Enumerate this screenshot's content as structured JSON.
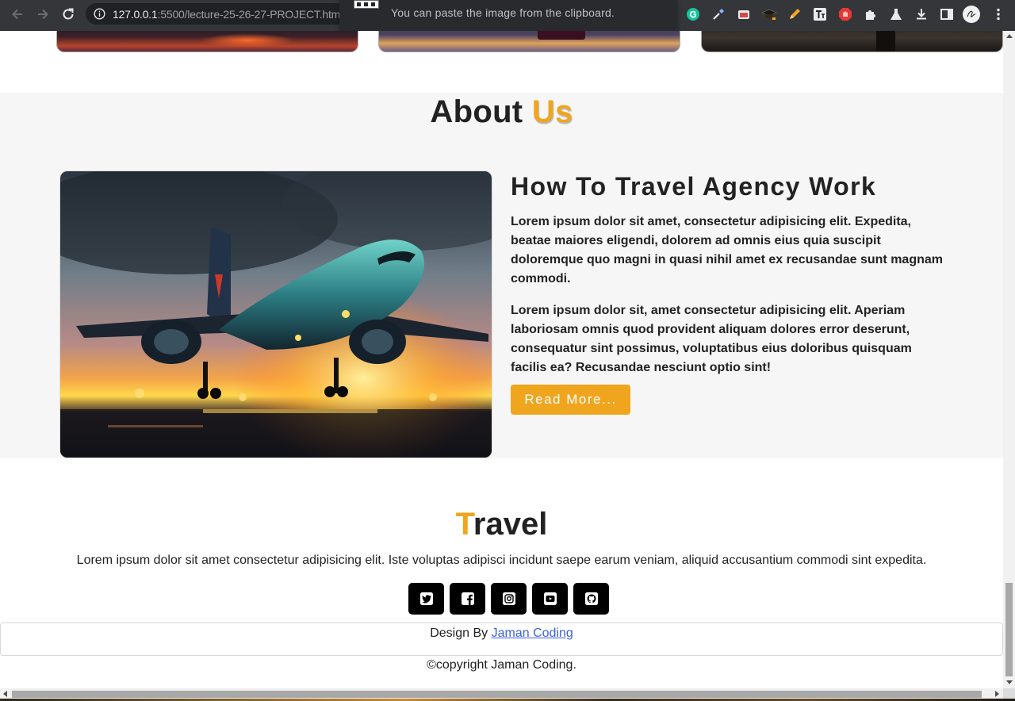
{
  "browser": {
    "url_host": "127.0.0.1",
    "url_rest": ":5500/lecture-25-26-27-PROJECT.html",
    "toast_text": "You can paste the image from the clipboard."
  },
  "icons": {
    "back": "arrow-left-icon",
    "forward": "arrow-right-icon",
    "reload": "reload-icon",
    "info": "info-icon",
    "extensions": [
      "grammarly-icon",
      "eyedropper-icon",
      "screenshot-icon",
      "graduation-cap-icon",
      "pencil-icon",
      "text-icon",
      "hand-stop-icon",
      "puzzle-icon",
      "flask-icon",
      "download-icon",
      "sidebar-icon",
      "profile-avatar-icon",
      "kebab-menu-icon"
    ]
  },
  "colors": {
    "accent": "#f0a51e",
    "link": "#3b62e0",
    "social_bg": "#000000"
  },
  "about": {
    "title_main": "About ",
    "title_accent": "Us",
    "heading": "How To Travel Agency Work",
    "paragraph_1": "Lorem ipsum dolor sit amet, consectetur adipisicing elit. Expedita, beatae maiores eligendi, dolorem ad omnis eius quia suscipit doloremque quo magni in quasi nihil amet ex recusandae sunt magnam commodi.",
    "paragraph_2": "Lorem ipsum dolor sit, amet consectetur adipisicing elit. Aperiam laboriosam omnis quod provident aliquam dolores error deserunt, consequatur sint possimus, voluptatibus eius doloribus quisquam facilis ea? Recusandae nesciunt optio sint!",
    "button": "Read More..."
  },
  "footer": {
    "brand_accent": "T",
    "brand_rest": "ravel",
    "description": "Lorem ipsum dolor sit amet consectetur adipisicing elit. Iste voluptas adipisci incidunt saepe earum veniam, aliquid accusantium commodi sint expedita.",
    "socials": [
      "twitter-icon",
      "facebook-icon",
      "instagram-icon",
      "youtube-icon",
      "github-icon"
    ],
    "credit_prefix": "Design By ",
    "credit_link": "Jaman Coding",
    "copyright": "©copyright Jaman Coding."
  }
}
